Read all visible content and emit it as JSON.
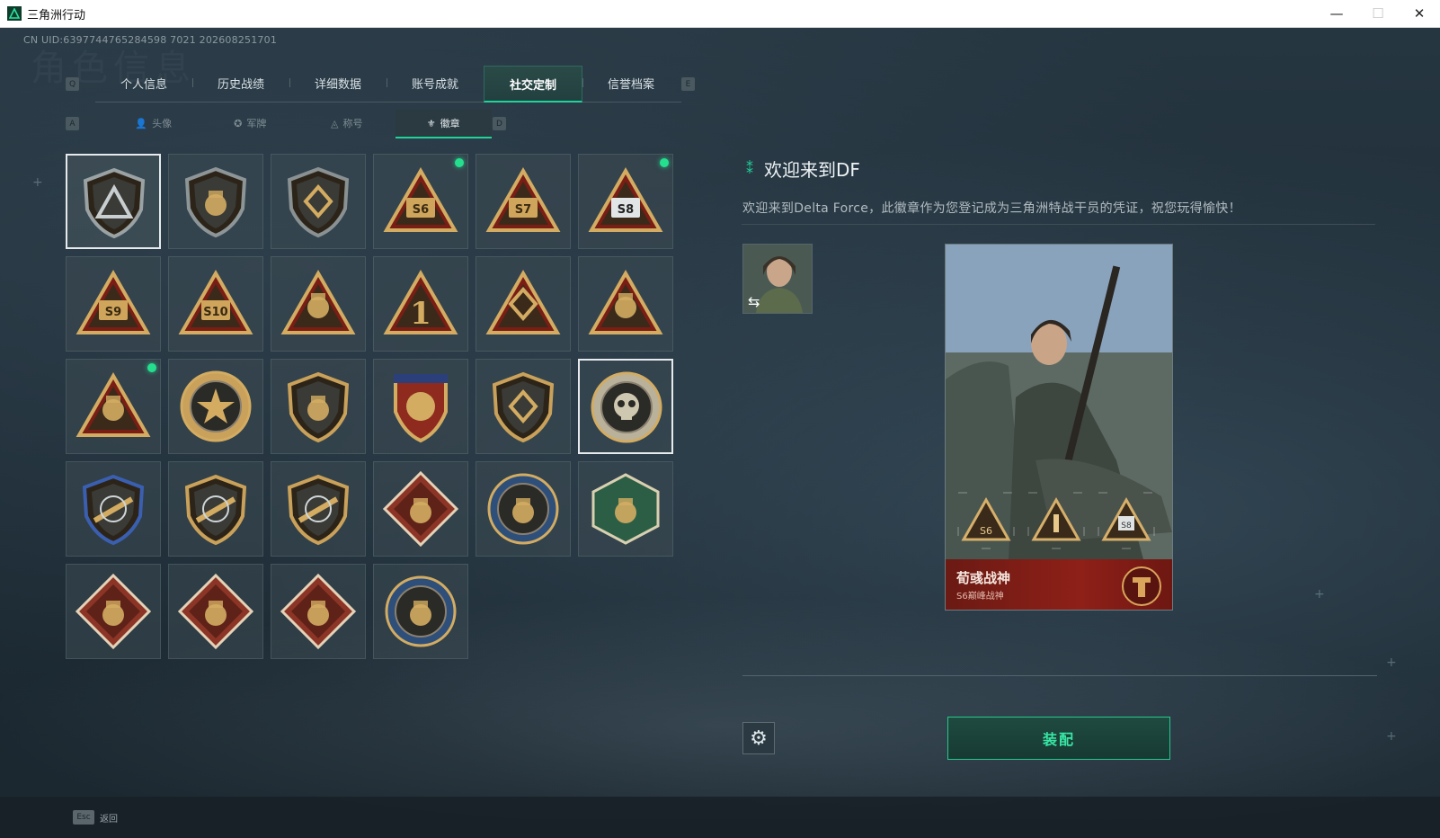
{
  "window": {
    "title": "三角洲行动",
    "minimize": "—",
    "maximize": "☐",
    "close": "✕"
  },
  "header": {
    "uid": "CN UID:6397744765284598 7021 202608251701",
    "bg_title": "角色信息",
    "left_key": "Q",
    "right_key": "E"
  },
  "main_tabs": [
    {
      "label": "个人信息",
      "active": false
    },
    {
      "label": "历史战绩",
      "active": false
    },
    {
      "label": "详细数据",
      "active": false
    },
    {
      "label": "账号成就",
      "active": false
    },
    {
      "label": "社交定制",
      "active": true
    },
    {
      "label": "信誉档案",
      "active": false
    }
  ],
  "sub_tabs": {
    "left_key": "A",
    "right_key": "D",
    "items": [
      {
        "icon": "avatar-icon",
        "glyph": "👤",
        "label": "头像",
        "active": false
      },
      {
        "icon": "military-card-icon",
        "glyph": "✪",
        "label": "军牌",
        "active": false
      },
      {
        "icon": "title-icon",
        "glyph": "◬",
        "label": "称号",
        "active": false
      },
      {
        "icon": "badge-icon",
        "glyph": "⚜",
        "label": "徽章",
        "active": true
      }
    ]
  },
  "badges": [
    {
      "name": "delta-shield-badge",
      "shape": "shield",
      "accent": "#9aa2a4",
      "mark": "tri",
      "new": false,
      "selected": true
    },
    {
      "name": "helicopter-badge",
      "shape": "shield",
      "accent": "#8d9597",
      "mark": "heli",
      "new": false
    },
    {
      "name": "diamond-emblem-badge",
      "shape": "shield",
      "accent": "#8a9193",
      "mark": "diamond",
      "new": false
    },
    {
      "name": "s6-badge",
      "shape": "triangle",
      "accent": "#c9a15a",
      "mark": "S6",
      "new": true
    },
    {
      "name": "s7-badge",
      "shape": "triangle",
      "accent": "#c9a15a",
      "mark": "S7",
      "new": false
    },
    {
      "name": "s8-badge",
      "shape": "triangle",
      "accent": "#c9a15a",
      "mark": "S8",
      "new": true
    },
    {
      "name": "s9-badge",
      "shape": "triangle",
      "accent": "#c9a15a",
      "mark": "S9",
      "new": false
    },
    {
      "name": "s10-badge",
      "shape": "triangle",
      "accent": "#c9a15a",
      "mark": "S10",
      "new": false
    },
    {
      "name": "bird-triangle-badge",
      "shape": "triangle",
      "accent": "#c9a15a",
      "mark": "bird",
      "new": false
    },
    {
      "name": "number-one-badge",
      "shape": "triangle",
      "accent": "#c9a15a",
      "mark": "1",
      "new": false
    },
    {
      "name": "gem-hands-badge",
      "shape": "triangle",
      "accent": "#c9a15a",
      "mark": "gem",
      "new": false
    },
    {
      "name": "squad-badge",
      "shape": "triangle",
      "accent": "#c9a15a",
      "mark": "squad",
      "new": false
    },
    {
      "name": "rocket-badge",
      "shape": "triangle",
      "accent": "#c9a15a",
      "mark": "rocket",
      "new": true
    },
    {
      "name": "star-medal-badge",
      "shape": "circle",
      "accent": "#c9a15a",
      "mark": "star",
      "new": false
    },
    {
      "name": "gold-shield-badge",
      "shape": "shield",
      "accent": "#c9a15a",
      "mark": "chevron",
      "new": false
    },
    {
      "name": "three-star-crest-badge",
      "shape": "crest",
      "accent": "#c9a15a",
      "mark": "arrow",
      "new": false
    },
    {
      "name": "diamond-shield-badge",
      "shape": "shield",
      "accent": "#c9a15a",
      "mark": "gem",
      "new": false
    },
    {
      "name": "skull-roundel-badge",
      "shape": "circle",
      "accent": "#b9b19a",
      "mark": "skull",
      "new": false,
      "framed": true
    },
    {
      "name": "sniper-blue-shield-badge",
      "shape": "shield",
      "accent": "#3b5fb0",
      "mark": "rifle",
      "new": false
    },
    {
      "name": "rifle-dark-shield-badge",
      "shape": "shield",
      "accent": "#c9a15a",
      "mark": "rifle",
      "new": false
    },
    {
      "name": "laurel-rifle-badge",
      "shape": "shield",
      "accent": "#c9a15a",
      "mark": "rifle",
      "new": false
    },
    {
      "name": "wolf-diamond-badge",
      "shape": "diamond",
      "accent": "#8c3526",
      "mark": "wolf",
      "new": false
    },
    {
      "name": "eagle-roundel-badge",
      "shape": "circle",
      "accent": "#2e4f7a",
      "mark": "eagle",
      "new": false
    },
    {
      "name": "wasp-hex-badge",
      "shape": "hex",
      "accent": "#2c5e45",
      "mark": "wasp",
      "new": false
    },
    {
      "name": "dragon-diamond-badge-1",
      "shape": "diamond",
      "accent": "#8c3526",
      "mark": "dragon",
      "new": false
    },
    {
      "name": "dragon-diamond-badge-2",
      "shape": "diamond",
      "accent": "#8c3526",
      "mark": "dragon",
      "new": false
    },
    {
      "name": "runner-diamond-badge",
      "shape": "diamond",
      "accent": "#8c3526",
      "mark": "runner",
      "new": false
    },
    {
      "name": "lynx-roundel-badge",
      "shape": "circle",
      "accent": "#2e4f7a",
      "mark": "lynx",
      "new": false
    }
  ],
  "detail": {
    "title": "欢迎来到DF",
    "description": "欢迎来到Delta Force，此徽章作为您登记成为三角洲特战干员的凭证，祝您玩得愉快！",
    "avatar_swap": "⇆",
    "card": {
      "name": "荀彧战神",
      "subtitle": "S6巅峰战神",
      "slot_badges": [
        "S6",
        "",
        "S8"
      ]
    },
    "settings_icon": "⚙",
    "equip_label": "装配"
  },
  "footer": {
    "esc_key": "Esc",
    "back_label": "返回"
  },
  "colors": {
    "accent_green": "#1fd39a",
    "new_dot": "#24e08e",
    "card_footer": "#8e2018"
  }
}
